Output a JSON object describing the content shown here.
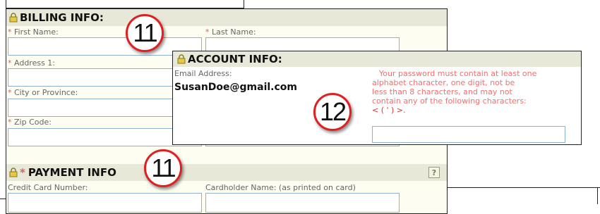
{
  "billing": {
    "title": "BILLING INFO:",
    "first_name_label": "First Name:",
    "last_name_label": "Last Name:",
    "address1_label": "Address 1:",
    "city_label": "City or Province:",
    "zip_label": "Zip Code:"
  },
  "account": {
    "title": "ACCOUNT INFO:",
    "email_label": "Email Address:",
    "email_value": "SusanDoe@gmail.com",
    "password_lines": [
      "Your password must contain at least one",
      "alphabet character, one digit, not be",
      "less than 8 characters, and may not",
      "contain any of the following characters:",
      "< ( ' ) >."
    ]
  },
  "payment": {
    "title_prefix": "*",
    "title": "PAYMENT INFO",
    "help_label": "?",
    "card_number_label": "Credit Card Number:",
    "cardholder_label": "Cardholder Name: (as printed on card)"
  },
  "badges": {
    "billing": "11",
    "payment": "11",
    "account": "12"
  },
  "required_marker": "*",
  "colors": {
    "header_bg": "#e8e8d8",
    "panel_bg": "#fdfdf2",
    "required": "#e06060",
    "field_border": "#8fb0cf",
    "badge_ring": "#e02020"
  }
}
